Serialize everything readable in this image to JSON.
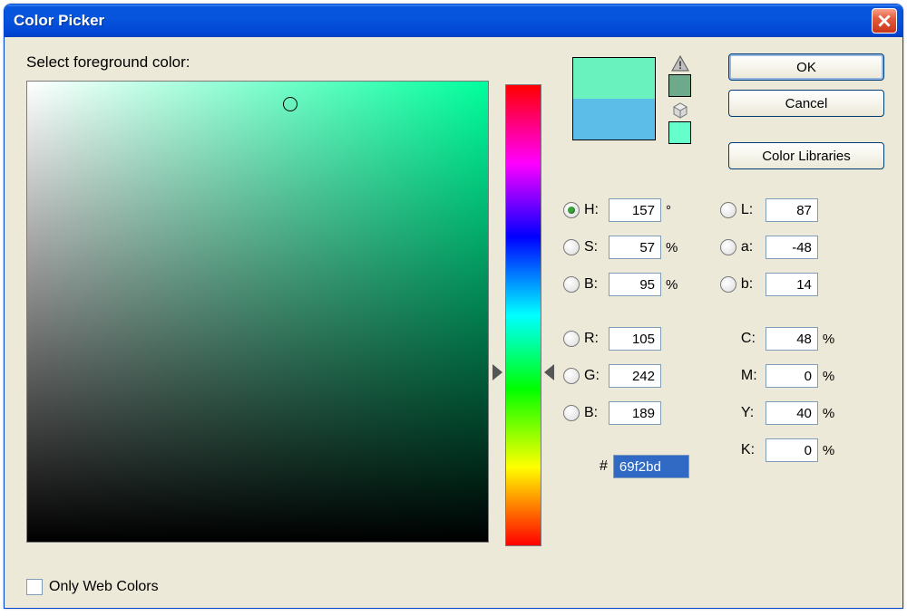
{
  "window": {
    "title": "Color Picker"
  },
  "prompt": "Select foreground color:",
  "swatch": {
    "new_color": "#69f2bd",
    "old_color": "#5bbde8",
    "gamut_warn": "#6ea98b",
    "websafe": "#66ffcc"
  },
  "buttons": {
    "ok": "OK",
    "cancel": "Cancel",
    "libraries": "Color Libraries"
  },
  "hsb": {
    "h_label": "H:",
    "h_val": "157",
    "h_unit": "°",
    "s_label": "S:",
    "s_val": "57",
    "s_unit": "%",
    "b_label": "B:",
    "b_val": "95",
    "b_unit": "%"
  },
  "rgb": {
    "r_label": "R:",
    "r_val": "105",
    "g_label": "G:",
    "g_val": "242",
    "b_label": "B:",
    "b_val": "189"
  },
  "lab": {
    "l_label": "L:",
    "l_val": "87",
    "a_label": "a:",
    "a_val": "-48",
    "b_label": "b:",
    "b_val": "14"
  },
  "cmyk": {
    "c_label": "C:",
    "c_val": "48",
    "m_label": "M:",
    "m_val": "0",
    "y_label": "Y:",
    "y_val": "40",
    "k_label": "K:",
    "k_val": "0",
    "unit": "%"
  },
  "hex": {
    "hash": "#",
    "val": "69f2bd"
  },
  "web_only": "Only Web Colors",
  "hue_pos_pct": 56.4
}
